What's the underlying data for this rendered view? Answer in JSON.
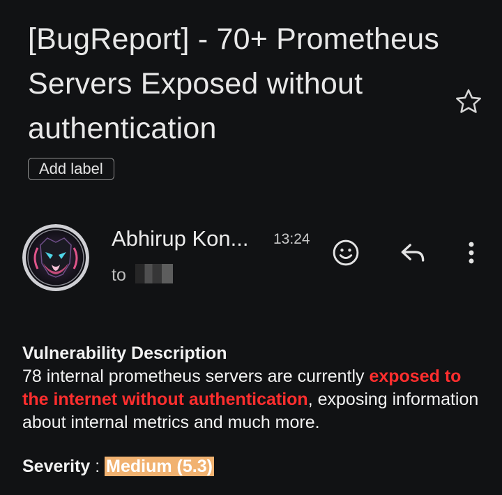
{
  "email": {
    "subject": "[BugReport] - 70+ Prometheus Servers Exposed without authentication",
    "add_label": "Add label",
    "sender": "Abhirup Kon...",
    "time": "13:24",
    "to_label": "to"
  },
  "icons": {
    "star": "star-outline-icon",
    "emoji": "emoji-reaction-icon",
    "reply": "reply-icon",
    "more": "more-vert-icon"
  },
  "body": {
    "heading": "Vulnerability Description",
    "text_before": " 78 internal prometheus servers are currently ",
    "text_highlight": "exposed to the internet without authentication",
    "text_after": ", exposing information about internal metrics and much more.",
    "severity_label": "Severity",
    "severity_sep": " : ",
    "severity_value": "Medium (5.3)"
  },
  "colors": {
    "background": "#111214",
    "highlight_red": "#ff2e2e",
    "severity_bg": "#f1b271"
  }
}
